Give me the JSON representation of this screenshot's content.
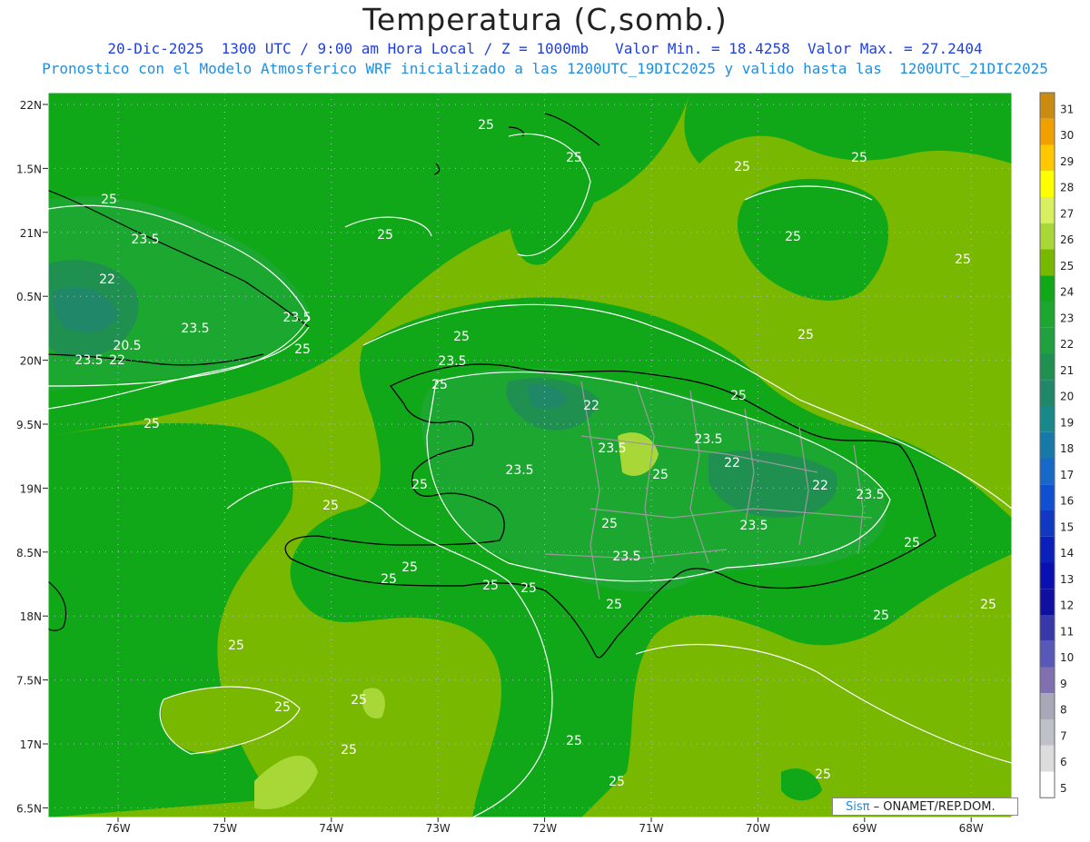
{
  "header": {
    "title": "Temperatura (C,somb.)",
    "info_line": "20-Dic-2025  1300 UTC / 9:00 am Hora Local / Z = 1000mb   Valor Min. = 18.4258  Valor Max. = 27.2404",
    "model_line": "Pronostico con el Modelo Atmosferico WRF inicializado a las 1200UTC_19DIC2025 y valido hasta las  1200UTC_21DIC2025"
  },
  "axes": {
    "lat_labels": [
      "22N",
      "1.5N",
      "21N",
      "0.5N",
      "20N",
      "9.5N",
      "19N",
      "8.5N",
      "18N",
      "7.5N",
      "17N",
      "6.5N"
    ],
    "lon_labels": [
      "76W",
      "75W",
      "74W",
      "73W",
      "72W",
      "71W",
      "70W",
      "69W",
      "68W"
    ]
  },
  "colorbar": {
    "levels": [
      "31",
      "30",
      "29",
      "28",
      "27",
      "26",
      "25",
      "24",
      "23",
      "22",
      "21",
      "20",
      "19",
      "18",
      "17",
      "16",
      "15",
      "14",
      "13",
      "12",
      "11",
      "10",
      "9",
      "8",
      "7",
      "6",
      "5"
    ],
    "colors": [
      "#c98c10",
      "#f0a000",
      "#ffc800",
      "#ffff00",
      "#d8f060",
      "#a8d838",
      "#78b800",
      "#10a818",
      "#1ca830",
      "#20a040",
      "#209050",
      "#208868",
      "#18888a",
      "#1878a8",
      "#1868c8",
      "#1050d0",
      "#1038c0",
      "#0a20b8",
      "#0a10b0",
      "#1010a0",
      "#3838a8",
      "#5858b8",
      "#8070b0",
      "#a8a8b8",
      "#c0c0c8",
      "#dcdcdc",
      "#ffffff"
    ]
  },
  "contour_labels": [
    {
      "text": "25"
    },
    {
      "text": "25"
    },
    {
      "text": "25"
    },
    {
      "text": "25"
    },
    {
      "text": "25"
    },
    {
      "text": "25"
    },
    {
      "text": "25"
    },
    {
      "text": "25"
    },
    {
      "text": "25"
    },
    {
      "text": "25"
    },
    {
      "text": "23.5"
    },
    {
      "text": "22"
    },
    {
      "text": "23.5"
    },
    {
      "text": "23.5"
    },
    {
      "text": "20.5"
    },
    {
      "text": "23.5"
    },
    {
      "text": "22"
    },
    {
      "text": "25"
    },
    {
      "text": "25"
    },
    {
      "text": "23.5"
    },
    {
      "text": "25"
    },
    {
      "text": "22"
    },
    {
      "text": "23.5"
    },
    {
      "text": "23.5"
    },
    {
      "text": "25"
    },
    {
      "text": "23.5"
    },
    {
      "text": "25"
    },
    {
      "text": "22"
    },
    {
      "text": "22"
    },
    {
      "text": "23.5"
    },
    {
      "text": "23.5"
    },
    {
      "text": "25"
    },
    {
      "text": "25"
    },
    {
      "text": "23.5"
    },
    {
      "text": "25"
    },
    {
      "text": "25"
    },
    {
      "text": "25"
    },
    {
      "text": "25"
    },
    {
      "text": "25"
    },
    {
      "text": "25"
    },
    {
      "text": "25"
    },
    {
      "text": "25"
    },
    {
      "text": "25"
    },
    {
      "text": "25"
    },
    {
      "text": "25"
    },
    {
      "text": "25"
    },
    {
      "text": "25"
    },
    {
      "text": "25"
    },
    {
      "text": "25"
    },
    {
      "text": "25"
    }
  ],
  "credit": {
    "brand": "Sisπ",
    "org": "– ONAMET/REP.DOM."
  }
}
